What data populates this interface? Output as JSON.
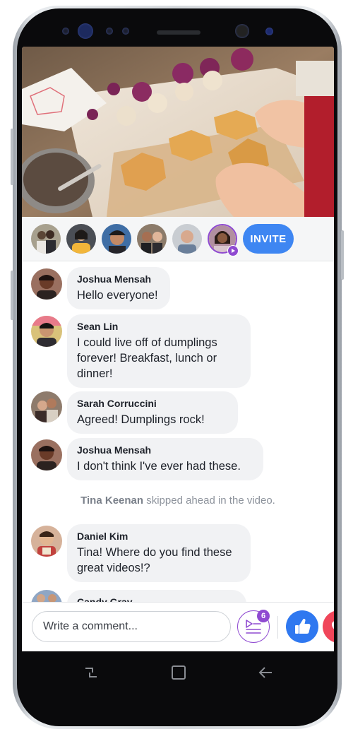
{
  "avatar_row": {
    "invite_label": "INVITE",
    "people": [
      "avatar-1",
      "avatar-2",
      "avatar-3",
      "avatar-4",
      "avatar-5",
      "avatar-6-host"
    ]
  },
  "messages": [
    {
      "name": "Joshua Mensah",
      "text": "Hello everyone!"
    },
    {
      "name": "Sean Lin",
      "text": "I could live off of dumplings forever! Breakfast, lunch or dinner!"
    },
    {
      "name": "Sarah Corruccini",
      "text": "Agreed! Dumplings rock!"
    },
    {
      "name": "Joshua Mensah",
      "text": "I don't think I've ever had these."
    },
    {
      "name": "Daniel Kim",
      "text": "Tina! Where do you find these great videos!?"
    },
    {
      "name": "Candy Gray",
      "text": ""
    }
  ],
  "system_event": {
    "actor": "Tina Keenan",
    "action": " skipped ahead in the video."
  },
  "composer": {
    "placeholder": "Write a comment...",
    "queue_count": "6"
  },
  "colors": {
    "accent_blue": "#3e86f2",
    "like_blue": "#2f78f0",
    "love_red": "#f0465a",
    "queue_purple": "#8f4ad1",
    "bubble_gray": "#f1f2f4"
  },
  "icons": {
    "like": "thumbs-up-icon",
    "love": "heart-icon",
    "queue": "playlist-queue-icon",
    "nav_recent": "recent-apps-icon",
    "nav_home": "home-icon",
    "nav_back": "back-arrow-icon"
  }
}
